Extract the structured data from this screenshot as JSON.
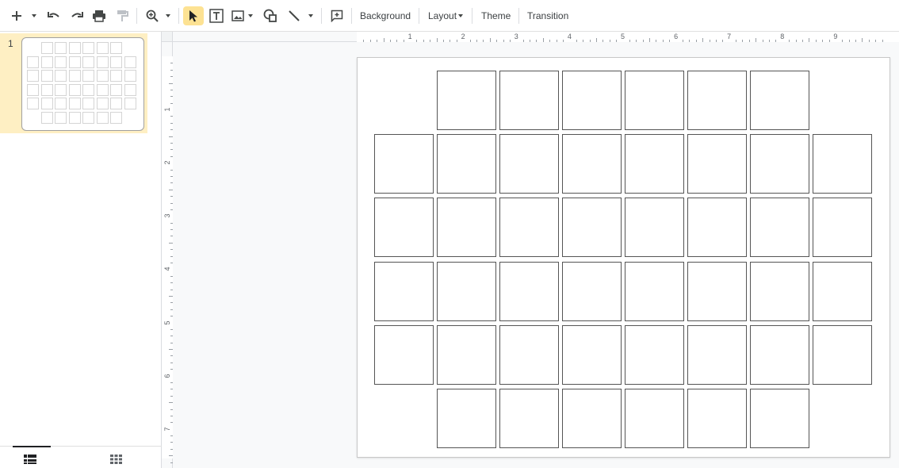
{
  "toolbar": {
    "new_icon": "plus-icon",
    "background_label": "Background",
    "layout_label": "Layout",
    "theme_label": "Theme",
    "transition_label": "Transition"
  },
  "filmstrip": {
    "slides": [
      {
        "number": "1",
        "selected": true
      }
    ]
  },
  "ruler": {
    "horizontal_labels": [
      "1",
      "2",
      "3",
      "4",
      "5",
      "6",
      "7",
      "8",
      "9"
    ],
    "vertical_labels": [
      "1",
      "2",
      "3",
      "4",
      "5",
      "6",
      "7"
    ]
  },
  "slide": {
    "grid_rows": [
      {
        "cells": 6
      },
      {
        "cells": 8
      },
      {
        "cells": 8
      },
      {
        "cells": 8
      },
      {
        "cells": 8
      },
      {
        "cells": 6
      }
    ]
  },
  "colors": {
    "selection_highlight": "#fde293",
    "thumbnail_selected_bg": "#feefc3",
    "cell_border": "#555555"
  }
}
